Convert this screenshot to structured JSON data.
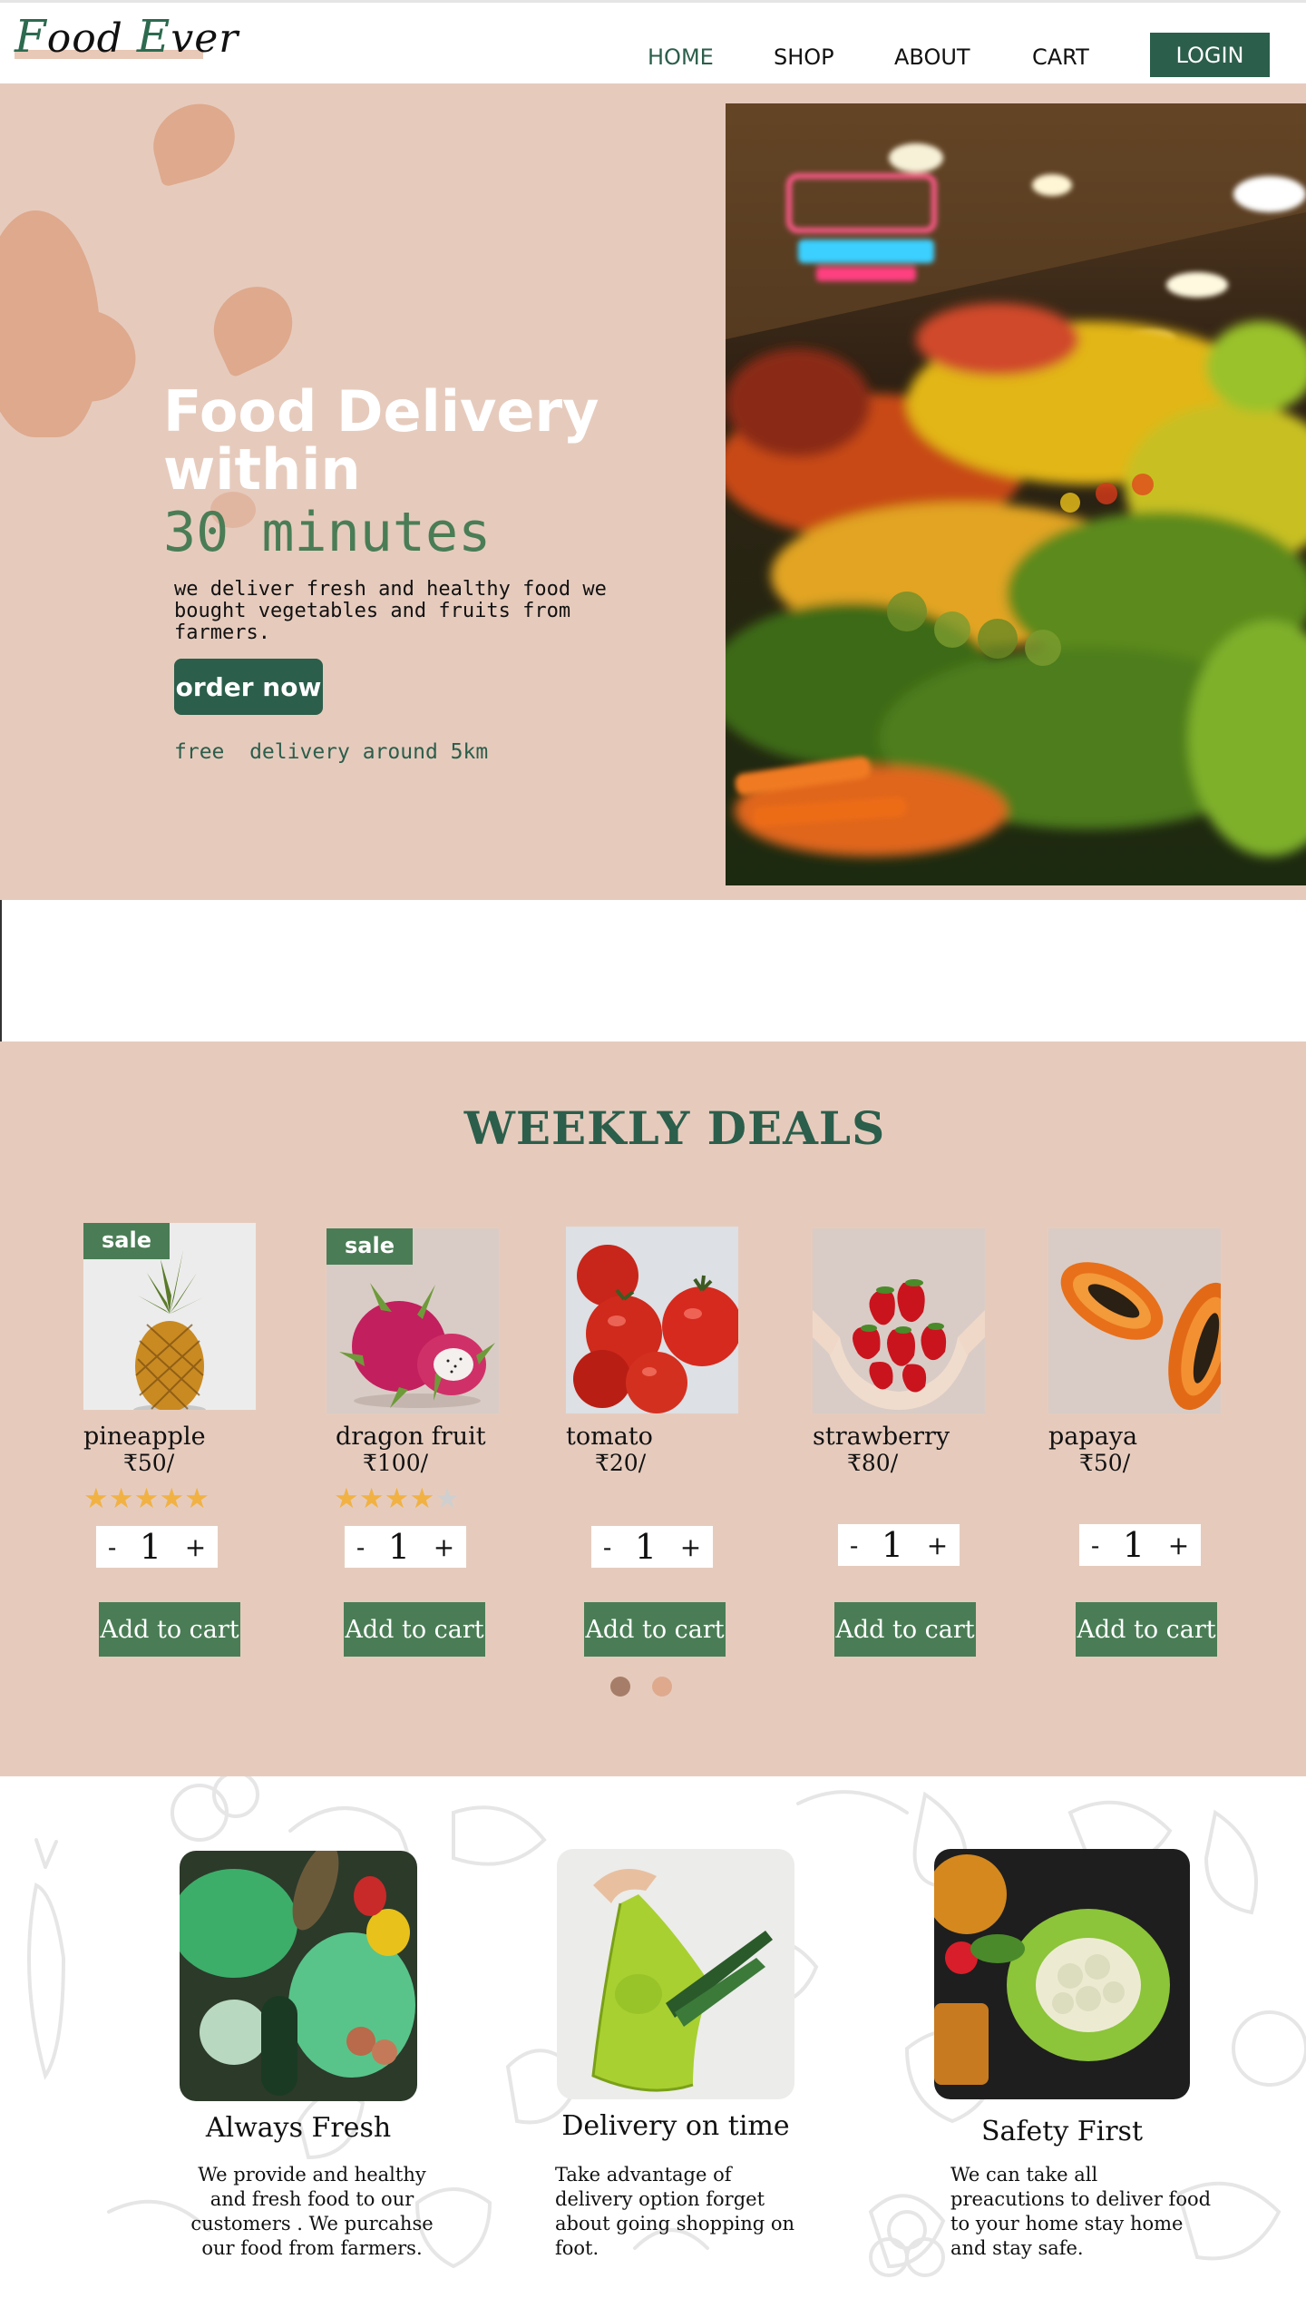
{
  "brand": {
    "logo_cap1": "F",
    "logo_rest1": "ood ",
    "logo_cap2": "E",
    "logo_rest2": "ver"
  },
  "nav": {
    "home": "HOME",
    "shop": "SHOP",
    "about": "ABOUT",
    "cart": "CART",
    "login": "LOGIN"
  },
  "hero": {
    "title": "Food Delivery within",
    "highlight": "30 minutes",
    "description": "we deliver fresh and healthy food we bought vegetables and fruits from farmers.",
    "cta": "order now",
    "note": "free  delivery around 5km"
  },
  "deals": {
    "title": "WEEKLY DEALS",
    "add_label": "Add to cart",
    "products": [
      {
        "name": "pineapple",
        "price": "₹50/",
        "sale": "sale",
        "rating": 5,
        "qty": "1"
      },
      {
        "name": "dragon fruit",
        "price": "₹100/",
        "sale": "sale",
        "rating": 4,
        "qty": "1"
      },
      {
        "name": "tomato",
        "price": "₹20/",
        "qty": "1"
      },
      {
        "name": "strawberry",
        "price": "₹80/",
        "qty": "1"
      },
      {
        "name": "papaya",
        "price": "₹50/",
        "qty": "1"
      }
    ],
    "minus": "-",
    "plus": "+",
    "star": "★",
    "pages": 2,
    "active_page": 1
  },
  "features": [
    {
      "title": "Always Fresh",
      "text": "We provide and healthy and fresh food to our customers .  We purcahse our food from farmers."
    },
    {
      "title": "Delivery on time",
      "text": "Take advantage of delivery option forget about going shopping on foot."
    },
    {
      "title": "Safety First",
      "text": "We can take all preacutions to deliver food to your home stay home and stay safe."
    }
  ],
  "colors": {
    "primary": "#2b5e4b",
    "accent_green": "#4a7d55",
    "peach": "#e6cbbd",
    "star": "#f1b243"
  },
  "icons": [
    "pineapple-image",
    "dragon-fruit-image",
    "tomato-image",
    "strawberry-image",
    "papaya-image",
    "market-photo"
  ]
}
